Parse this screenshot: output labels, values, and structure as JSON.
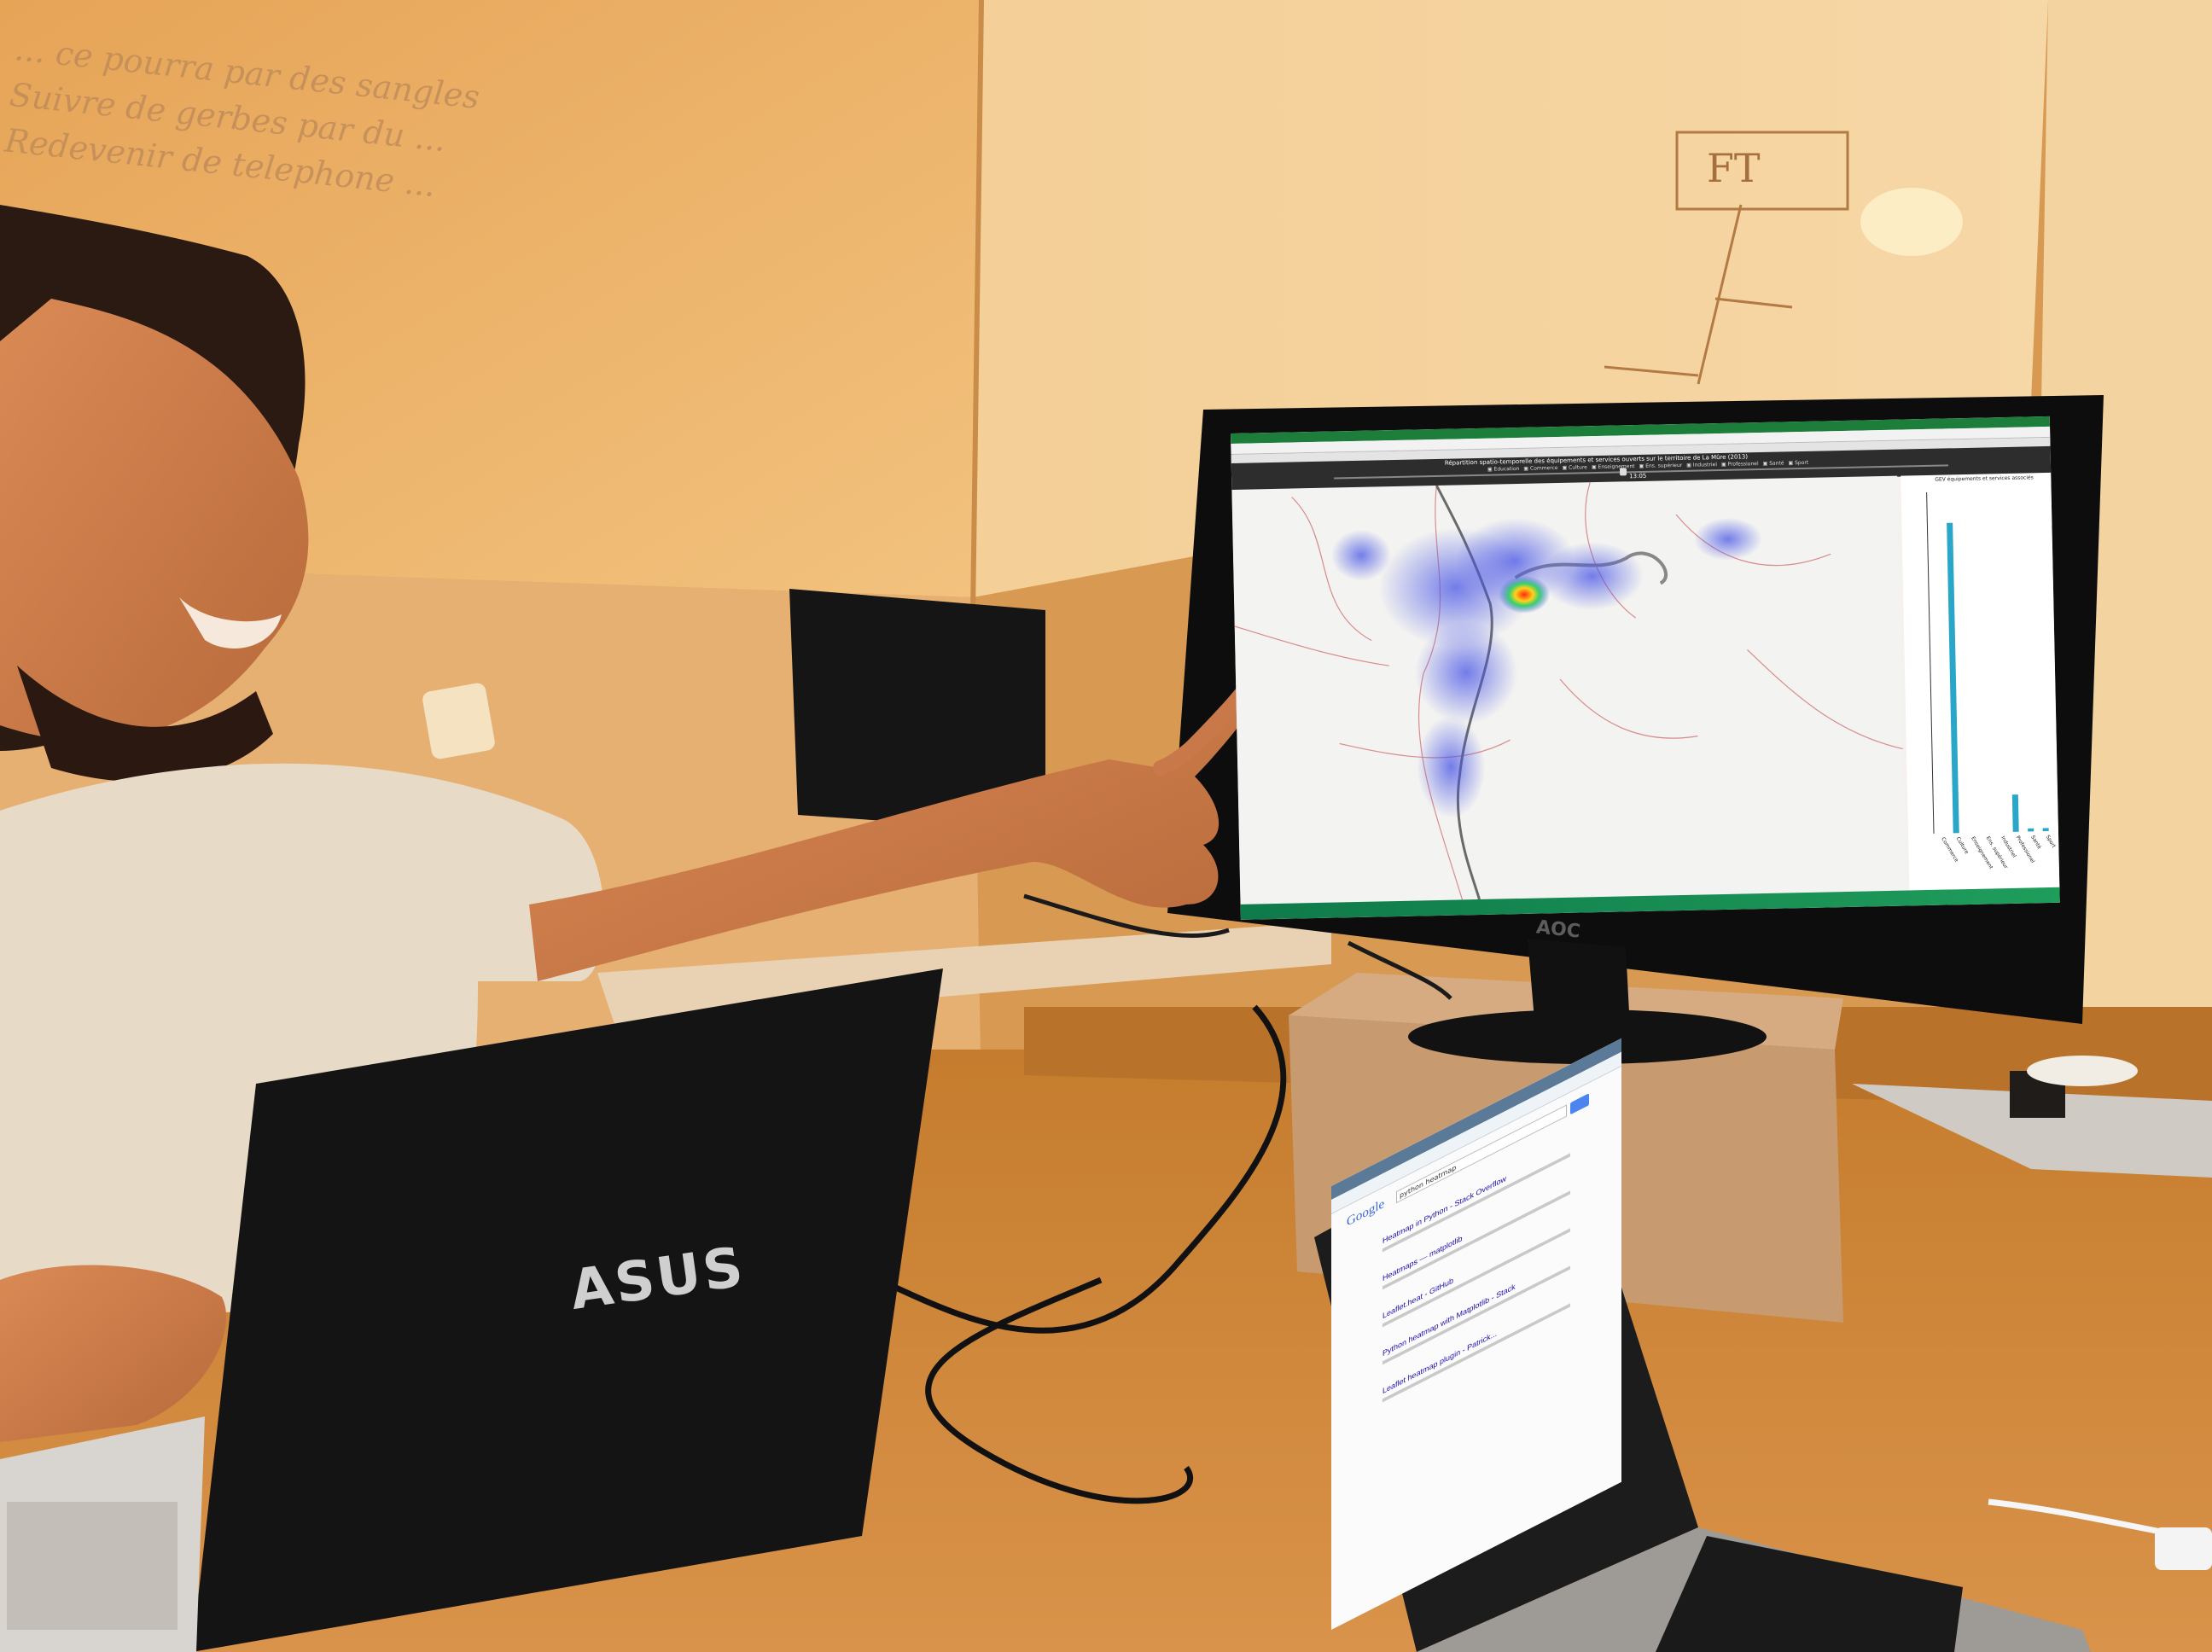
{
  "photo": {
    "laptop_brand": "ASUS",
    "monitor_brand": "AOC"
  },
  "whiteboard_left": {
    "lines": [
      "... ce pourra par des sangles",
      "Suivre de gerbes par du ...",
      "Redevenir de telephone ..."
    ]
  },
  "whiteboard_right": {
    "box_label": "FT"
  },
  "monitor_screen": {
    "map_title": "Répartition spatio-temporelle des équipements et services ouverts sur le territoire de La Mûre (2013)",
    "layers": [
      "Education",
      "Commerce",
      "Culture",
      "Enseignement",
      "Ens. supérieur",
      "Industriel",
      "Professionel",
      "Santé",
      "Sport"
    ],
    "time": "13:05",
    "chart_title": "GEV équipements et services associés"
  },
  "chart_data": {
    "type": "bar",
    "categories": [
      "Commerce",
      "Culture",
      "Enseignement",
      "Ens. supérieur",
      "Industriel",
      "Professionel",
      "Santé",
      "Sport"
    ],
    "values": [
      0,
      100,
      0,
      0,
      0,
      12,
      1,
      1
    ],
    "title": "GEV équipements et services associés",
    "xlabel": "",
    "ylabel": "",
    "ylim": [
      0,
      110
    ]
  },
  "laptop_screen": {
    "search_logo": "Google",
    "search_query": "python heatmap",
    "results": [
      "Heatmap in Python - Stack Overflow",
      "Heatmaps — matplotlib",
      "Leaflet.heat - GitHub",
      "Python heatmap with Matplotlib - Stack",
      "Leaflet heatmap plugin - Patrick..."
    ]
  }
}
